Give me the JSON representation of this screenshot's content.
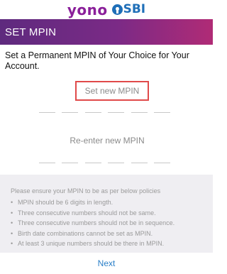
{
  "brand": {
    "yono": "yono",
    "sbi": "SBI",
    "logo_icon": "sbi-logo-icon"
  },
  "header": {
    "title": "SET MPIN"
  },
  "instruction": "Set a Permanent MPIN of Your Choice for Your Account.",
  "mpin_new": {
    "label": "Set new MPIN",
    "digits": 6
  },
  "mpin_reenter": {
    "label": "Re-enter new MPIN",
    "digits": 6
  },
  "policies": {
    "intro": "Please ensure your MPIN to be as per below policies",
    "items": [
      "MPIN should be 6 digits in length.",
      "Three consecutive numbers should not be same.",
      "Three consecutive numbers should not be in sequence.",
      "Birth date combinations cannot be set as MPIN.",
      "At least 3 unique numbers should be there in MPIN."
    ]
  },
  "footer": {
    "next_label": "Next"
  },
  "colors": {
    "accent_purple": "#7b2a86",
    "accent_pink": "#b02b76",
    "link_blue": "#2a7fc8",
    "highlight_red": "#e04a4a"
  }
}
